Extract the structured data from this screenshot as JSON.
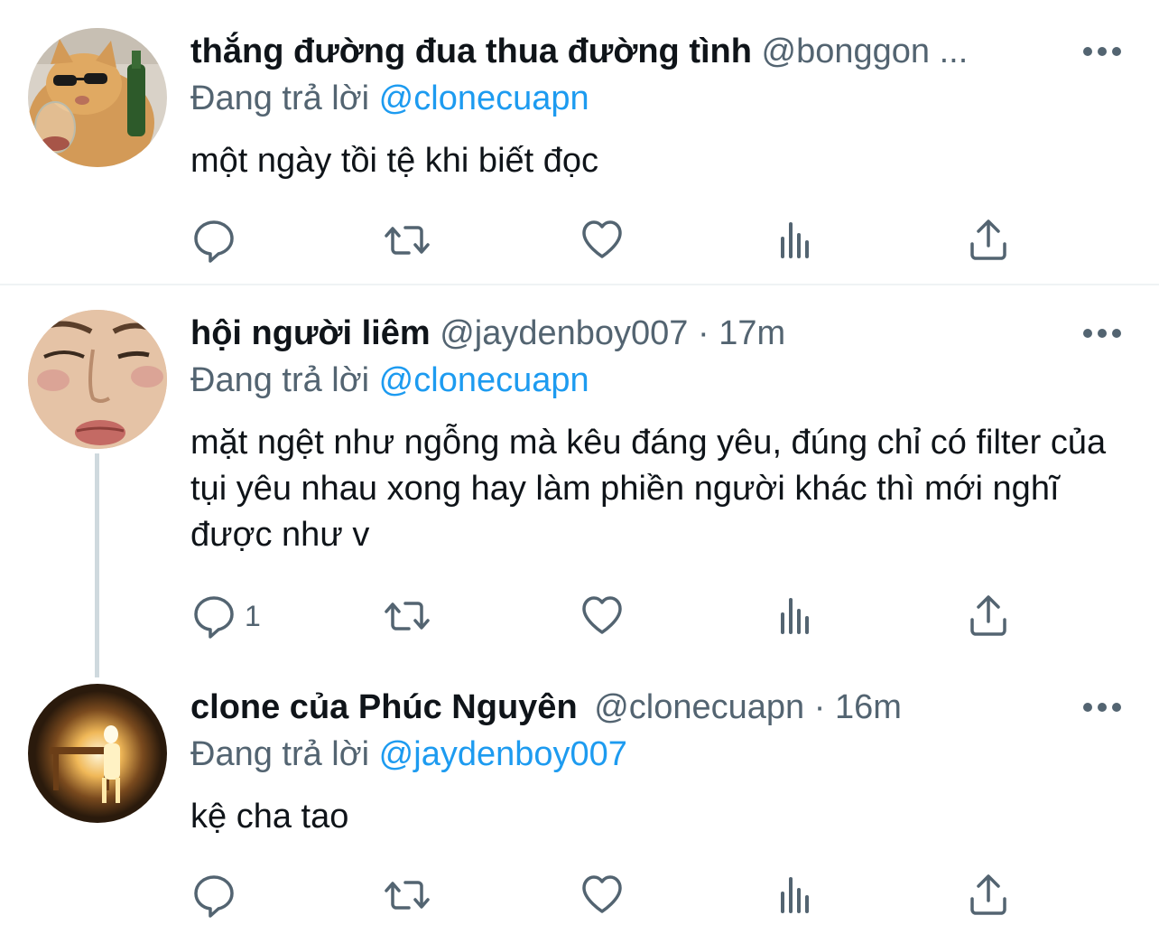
{
  "tweets": [
    {
      "name": "thắng đường đua thua đường tình",
      "handle": "@bonggon ...",
      "separator": "",
      "time": "",
      "reply_prefix": "Đang trả lời",
      "reply_to": "@clonecuapn",
      "text": "một ngày tồi tệ khi biết đọc",
      "reply_count": "",
      "avatar_icon": "cat-with-sunglasses-avatar"
    },
    {
      "name": "hội người liêm",
      "handle": "@jaydenboy007",
      "separator": "·",
      "time": "17m",
      "reply_prefix": "Đang trả lời",
      "reply_to": "@clonecuapn",
      "text": "mặt ngệt như ngỗng mà kêu đáng yêu, đúng chỉ có filter của tụi yêu nhau xong hay làm phiền người khác thì mới nghĩ được như v",
      "reply_count": "1",
      "avatar_icon": "face-closeup-avatar"
    },
    {
      "name": "clone của Phúc Nguyên",
      "handle": "@clonecuapn",
      "separator": "·",
      "time": "16m",
      "reply_prefix": "Đang trả lời",
      "reply_to": "@jaydenboy007",
      "text": "kệ cha tao",
      "reply_count": "",
      "avatar_icon": "glowing-figure-avatar"
    }
  ],
  "icons": {
    "reply": "reply-icon",
    "retweet": "retweet-icon",
    "like": "heart-icon",
    "views": "views-chart-icon",
    "share": "share-icon",
    "more": "more-dots-icon"
  },
  "colors": {
    "text": "#0f1419",
    "secondary": "#536471",
    "link": "#1d9bf0",
    "divider": "#eff3f4",
    "thread_line": "#cfd9de"
  }
}
